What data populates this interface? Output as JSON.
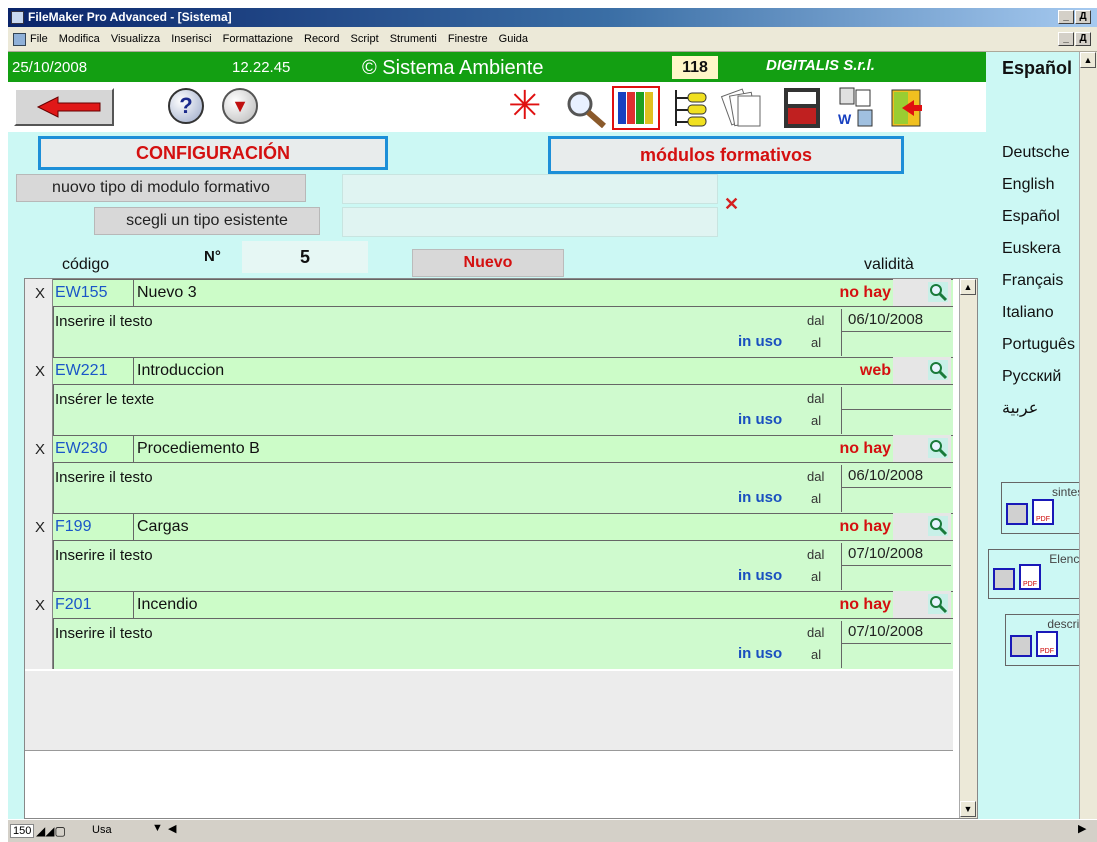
{
  "window": {
    "title": "FileMaker Pro Advanced - [Sistema]",
    "min_label": "_",
    "max_label": "Д",
    "close_label": "x"
  },
  "menu": [
    "File",
    "Modifica",
    "Visualizza",
    "Inserisci",
    "Formattazione",
    "Record",
    "Script",
    "Strumenti",
    "Finestre",
    "Guida"
  ],
  "header": {
    "date": "25/10/2008",
    "time": "12.22.45",
    "app_name": "© Sistema Ambiente",
    "count": "118",
    "company": "DIGITALIS S.r.l.",
    "current_lang": "Español"
  },
  "page": {
    "section_title": "CONFIGURACIÓN",
    "module_title": "módulos formativos",
    "new_type_label": "nuovo tipo di modulo formativo",
    "choose_type_label": "scegli un tipo esistente",
    "new_type_value": "",
    "choose_type_value": "",
    "clear_label": "✕",
    "code_header": "código",
    "count_label": "N°",
    "count_value": "5",
    "new_button": "Nuevo",
    "validity_header": "validità"
  },
  "records": [
    {
      "x": "X",
      "code": "EW155",
      "name": "Nuevo 3",
      "status": "no hay",
      "text": "Inserire il testo",
      "in_use": "in uso",
      "from_label": "dal",
      "to_label": "al",
      "from_date": "06/10/2008",
      "to_date": ""
    },
    {
      "x": "X",
      "code": "EW221",
      "name": "Introduccion",
      "status": "web",
      "text": "Insérer le texte",
      "in_use": "in uso",
      "from_label": "dal",
      "to_label": "al",
      "from_date": "",
      "to_date": ""
    },
    {
      "x": "X",
      "code": "EW230",
      "name": "Procediemento B",
      "status": "no hay",
      "text": "Inserire il testo",
      "in_use": "in uso",
      "from_label": "dal",
      "to_label": "al",
      "from_date": "06/10/2008",
      "to_date": ""
    },
    {
      "x": "X",
      "code": "F199",
      "name": "Cargas",
      "status": "no hay",
      "text": "Inserire il testo",
      "in_use": "in uso",
      "from_label": "dal",
      "to_label": "al",
      "from_date": "07/10/2008",
      "to_date": ""
    },
    {
      "x": "X",
      "code": "F201",
      "name": "Incendio",
      "status": "no hay",
      "text": "Inserire il testo",
      "in_use": "in uso",
      "from_label": "dal",
      "to_label": "al",
      "from_date": "07/10/2008",
      "to_date": ""
    }
  ],
  "languages": [
    "Deutsche",
    "English",
    "Español",
    "Euskera",
    "Français",
    "Italiano",
    "Português",
    "Русский",
    "عربية"
  ],
  "reports": [
    {
      "label": "sintesi",
      "pdf": "PDF"
    },
    {
      "label": "Elenco",
      "pdf": "PDF"
    },
    {
      "label": "descrip",
      "pdf": "PDF"
    }
  ],
  "statusbar": {
    "zoom": "150",
    "mode": "Usa"
  },
  "colors": {
    "header_green": "#139f12",
    "background": "#ccf8f4",
    "record_green": "#ccfcc8",
    "status_red": "#d41010",
    "code_blue": "#1a56c8"
  }
}
